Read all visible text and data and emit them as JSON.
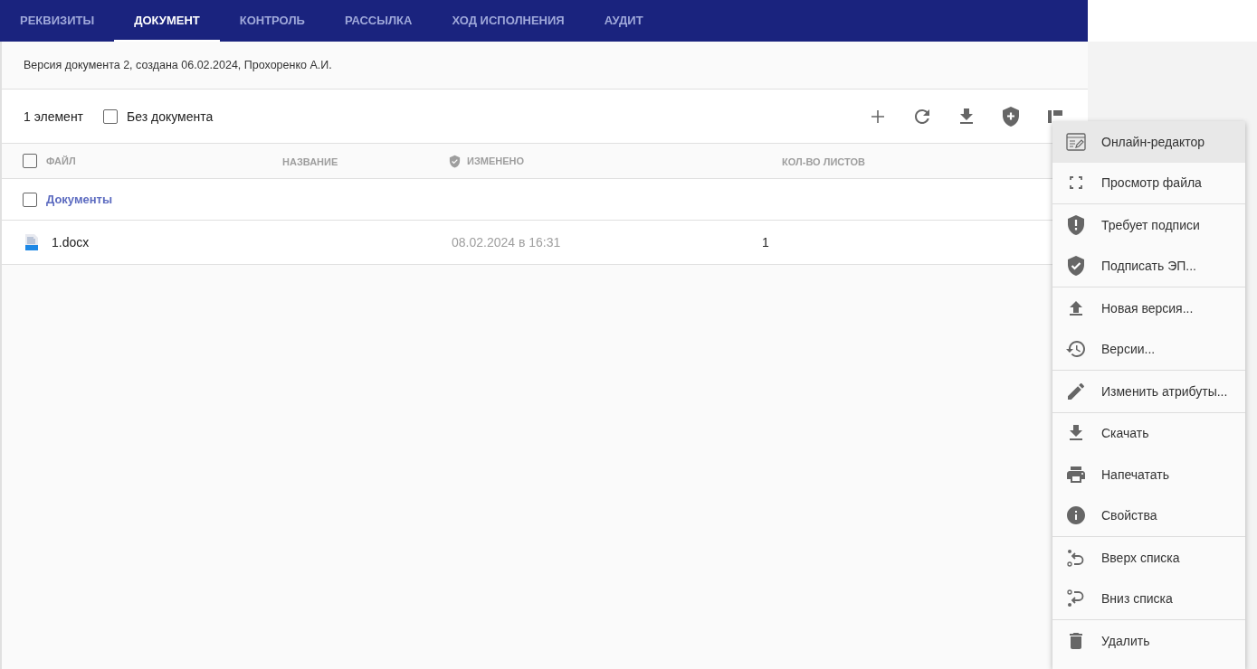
{
  "tabs": [
    {
      "label": "РЕКВИЗИТЫ",
      "selected": false
    },
    {
      "label": "ДОКУМЕНТ",
      "selected": true
    },
    {
      "label": "КОНТРОЛЬ",
      "selected": false
    },
    {
      "label": "РАССЫЛКА",
      "selected": false
    },
    {
      "label": "ХОД ИСПОЛНЕНИЯ",
      "selected": false
    },
    {
      "label": "АУДИТ",
      "selected": false
    }
  ],
  "version_info": "Версия документа 2, создана 06.02.2024, Прохоренко А.И.",
  "toolbar": {
    "count": "1 элемент",
    "without_document": {
      "label": "Без документа",
      "checked": false
    }
  },
  "table": {
    "select_all_checked": false,
    "columns": [
      "ФАЙЛ",
      "НАЗВАНИЕ",
      "ИЗМЕНЕНО",
      "КОЛ-ВО ЛИСТОВ"
    ],
    "groups": [
      {
        "name": "Документы",
        "checked": false,
        "rows": [
          {
            "file": "1.docx",
            "modified": "08.02.2024 в 16:31",
            "sheets": "1"
          }
        ]
      }
    ]
  },
  "context_menu": {
    "groups": [
      {
        "items": [
          {
            "label": "Онлайн-редактор",
            "highlighted": true
          },
          {
            "label": "Просмотр файла",
            "highlighted": false
          }
        ]
      },
      {
        "items": [
          {
            "label": "Требует подписи",
            "highlighted": false
          },
          {
            "label": "Подписать ЭП...",
            "highlighted": false
          }
        ]
      },
      {
        "items": [
          {
            "label": "Новая версия...",
            "highlighted": false
          },
          {
            "label": "Версии...",
            "highlighted": false
          }
        ]
      },
      {
        "items": [
          {
            "label": "Изменить атрибуты...",
            "highlighted": false
          }
        ]
      },
      {
        "items": [
          {
            "label": "Скачать",
            "highlighted": false
          },
          {
            "label": "Напечатать",
            "highlighted": false
          },
          {
            "label": "Свойства",
            "highlighted": false
          }
        ]
      },
      {
        "items": [
          {
            "label": "Вверх списка",
            "highlighted": false
          },
          {
            "label": "Вниз списка",
            "highlighted": false
          }
        ]
      },
      {
        "items": [
          {
            "label": "Удалить",
            "highlighted": false
          }
        ]
      }
    ]
  }
}
